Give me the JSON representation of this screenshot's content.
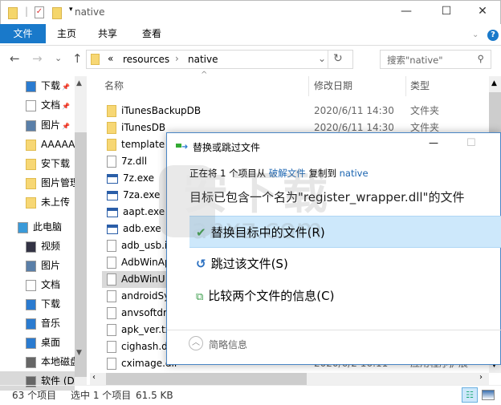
{
  "window": {
    "title": "native",
    "minimize": "—",
    "maximize": "☐",
    "close": "✕"
  },
  "ribbon": {
    "tabs": [
      "文件",
      "主页",
      "共享",
      "查看"
    ],
    "help": "?"
  },
  "nav": {
    "back": "←",
    "forward": "→",
    "recent": "⌄",
    "up": "↑",
    "breadcrumb": [
      "«",
      "resources",
      "›",
      "native"
    ],
    "refresh": "↻",
    "search_placeholder": "搜索\"native\""
  },
  "sidebar": {
    "items": [
      {
        "label": "下载",
        "icon": "download-icon",
        "pinned": true
      },
      {
        "label": "文档",
        "icon": "document-icon",
        "pinned": true
      },
      {
        "label": "图片",
        "icon": "picture-icon",
        "pinned": true
      },
      {
        "label": "AAAAA",
        "icon": "folder-icon"
      },
      {
        "label": "安下载",
        "icon": "folder-icon"
      },
      {
        "label": "图片管理",
        "icon": "folder-icon"
      },
      {
        "label": "未上传",
        "icon": "folder-icon"
      },
      {
        "label": "此电脑",
        "icon": "computer-icon"
      },
      {
        "label": "视频",
        "icon": "video-icon"
      },
      {
        "label": "图片",
        "icon": "picture-icon"
      },
      {
        "label": "文档",
        "icon": "document-icon"
      },
      {
        "label": "下载",
        "icon": "download-icon"
      },
      {
        "label": "音乐",
        "icon": "music-icon"
      },
      {
        "label": "桌面",
        "icon": "desktop-icon"
      },
      {
        "label": "本地磁盘",
        "icon": "drive-icon"
      },
      {
        "label": "软件 (D",
        "icon": "drive-icon",
        "selected": true
      }
    ]
  },
  "columns": {
    "name": "名称",
    "date": "修改日期",
    "type": "类型"
  },
  "files": [
    {
      "name": "iTunesBackupDB",
      "date": "2020/6/11 14:30",
      "type": "文件夹",
      "kind": "folder"
    },
    {
      "name": "iTunesDB",
      "date": "2020/6/11 14:30",
      "type": "文件夹",
      "kind": "folder"
    },
    {
      "name": "template",
      "kind": "folder"
    },
    {
      "name": "7z.dll",
      "kind": "dll"
    },
    {
      "name": "7z.exe",
      "kind": "exe"
    },
    {
      "name": "7za.exe",
      "kind": "exe"
    },
    {
      "name": "aapt.exe",
      "kind": "exe"
    },
    {
      "name": "adb.exe",
      "kind": "exe"
    },
    {
      "name": "adb_usb.i",
      "kind": "ini"
    },
    {
      "name": "AdbWinAp",
      "kind": "dll"
    },
    {
      "name": "AdbWinU",
      "kind": "dll",
      "selected": true
    },
    {
      "name": "androidSy",
      "kind": "dll"
    },
    {
      "name": "anvsoftdr",
      "kind": "dll"
    },
    {
      "name": "apk_ver.tx",
      "kind": "txt"
    },
    {
      "name": "cighash.d",
      "kind": "dll"
    },
    {
      "name": "cximage.dll",
      "date": "2020/6/2 16:11",
      "type": "应用程序扩展",
      "kind": "dll"
    }
  ],
  "status": {
    "count": "63 个项目",
    "selected": "选中 1 个项目",
    "size": "61.5 KB"
  },
  "dialog": {
    "title": "替换或跳过文件",
    "line_prefix": "正在将 1 个项目从",
    "source": "破解文件",
    "line_mid": "复制到",
    "dest": "native",
    "message": "目标已包含一个名为\"register_wrapper.dll\"的文件",
    "options": [
      {
        "label": "替换目标中的文件(R)",
        "icon": "check-icon"
      },
      {
        "label": "跳过该文件(S)",
        "icon": "skip-icon"
      },
      {
        "label": "比较两个文件的信息(C)",
        "icon": "compare-icon"
      }
    ],
    "details": "简略信息",
    "minimize": "—",
    "maximize": "☐",
    "watermark": "安下载 anxz.com"
  },
  "colors": {
    "accent": "#1979ca",
    "highlight": "#cde8fb",
    "link": "#1a64b0"
  }
}
